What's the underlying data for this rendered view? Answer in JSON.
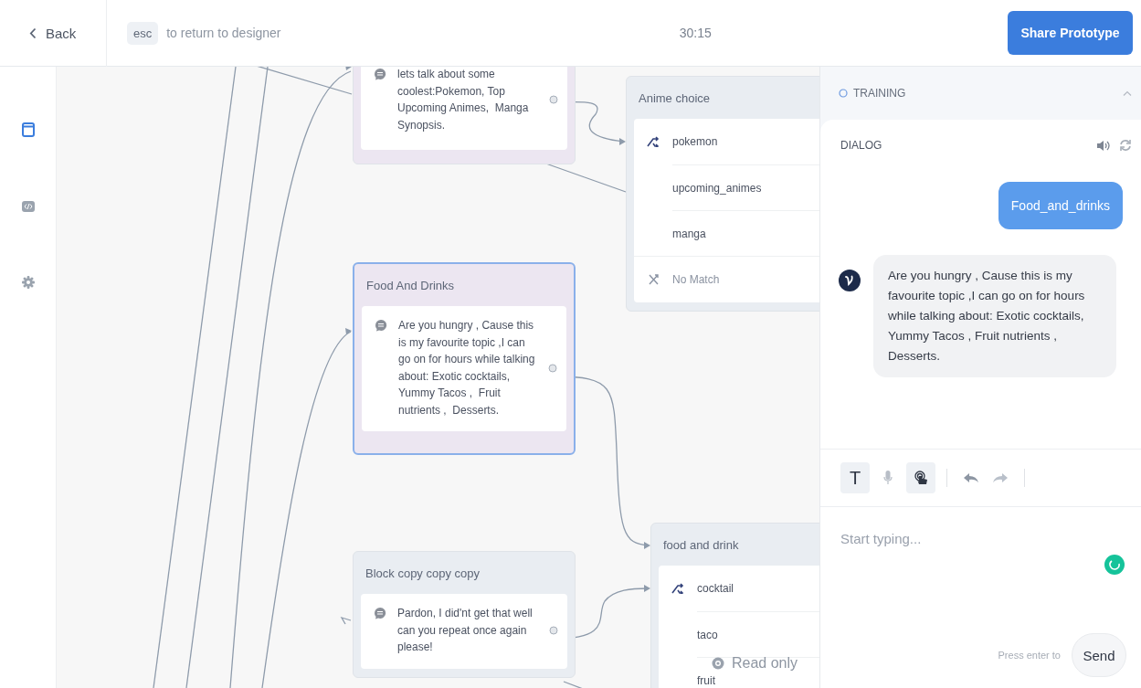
{
  "top_bar": {
    "back": "Back",
    "esc_key": "esc",
    "esc_hint": "to return to designer",
    "timer": "30:15",
    "share_button": "Share Prototype"
  },
  "sidebar": {
    "items": [
      {
        "kind": "screen",
        "selected": true
      },
      {
        "kind": "code",
        "selected": false
      },
      {
        "kind": "settings",
        "selected": false
      }
    ]
  },
  "canvas": {
    "nodes": [
      {
        "kind": "message",
        "color": "#ece6f1",
        "selected": false,
        "text": "lets talk about some coolest:Pokemon, Top Upcoming Animes,  Manga Synopsis."
      },
      {
        "kind": "choice",
        "title": "Anime choice",
        "color": "#e9edf2",
        "selected": false,
        "choices": [
          "pokemon",
          "upcoming_animes",
          "manga"
        ],
        "no_match": "No Match"
      },
      {
        "kind": "message",
        "title": "Food And Drinks",
        "color": "#ece6f1",
        "selected": true,
        "text": "Are you hungry , Cause this is my favourite topic ,I can go on for hours while talking about: Exotic cocktails, Yummy Tacos ,  Fruit nutrients ,  Desserts."
      },
      {
        "kind": "message",
        "title": "Block copy copy copy",
        "color": "#e9edf2",
        "selected": false,
        "text": "Pardon, I did'nt get that well can you repeat once again please!"
      },
      {
        "kind": "choice",
        "title": "food and drink",
        "color": "#e9edf2",
        "selected": false,
        "choices": [
          "cocktail",
          "taco",
          "fruit"
        ]
      }
    ],
    "read_only": "Read only"
  },
  "panel": {
    "section": "TRAINING",
    "expanded": true,
    "dialog_title": "DIALOG",
    "messages": [
      {
        "kind": "user",
        "text": "Food_and_drinks"
      },
      {
        "kind": "bot",
        "text": "Are you hungry , Cause this is my favourite topic ,I can go on for hours while talking about: Exotic cocktails, Yummy Tacos , Fruit nutrients , Desserts."
      }
    ],
    "tools": [
      {
        "kind": "text",
        "label": "T",
        "selected": true
      },
      {
        "kind": "voice",
        "selected": false
      },
      {
        "kind": "touch",
        "selected": true
      }
    ],
    "placeholder": "Start typing...",
    "send_hint": "Press enter to",
    "send_button": "Send"
  }
}
